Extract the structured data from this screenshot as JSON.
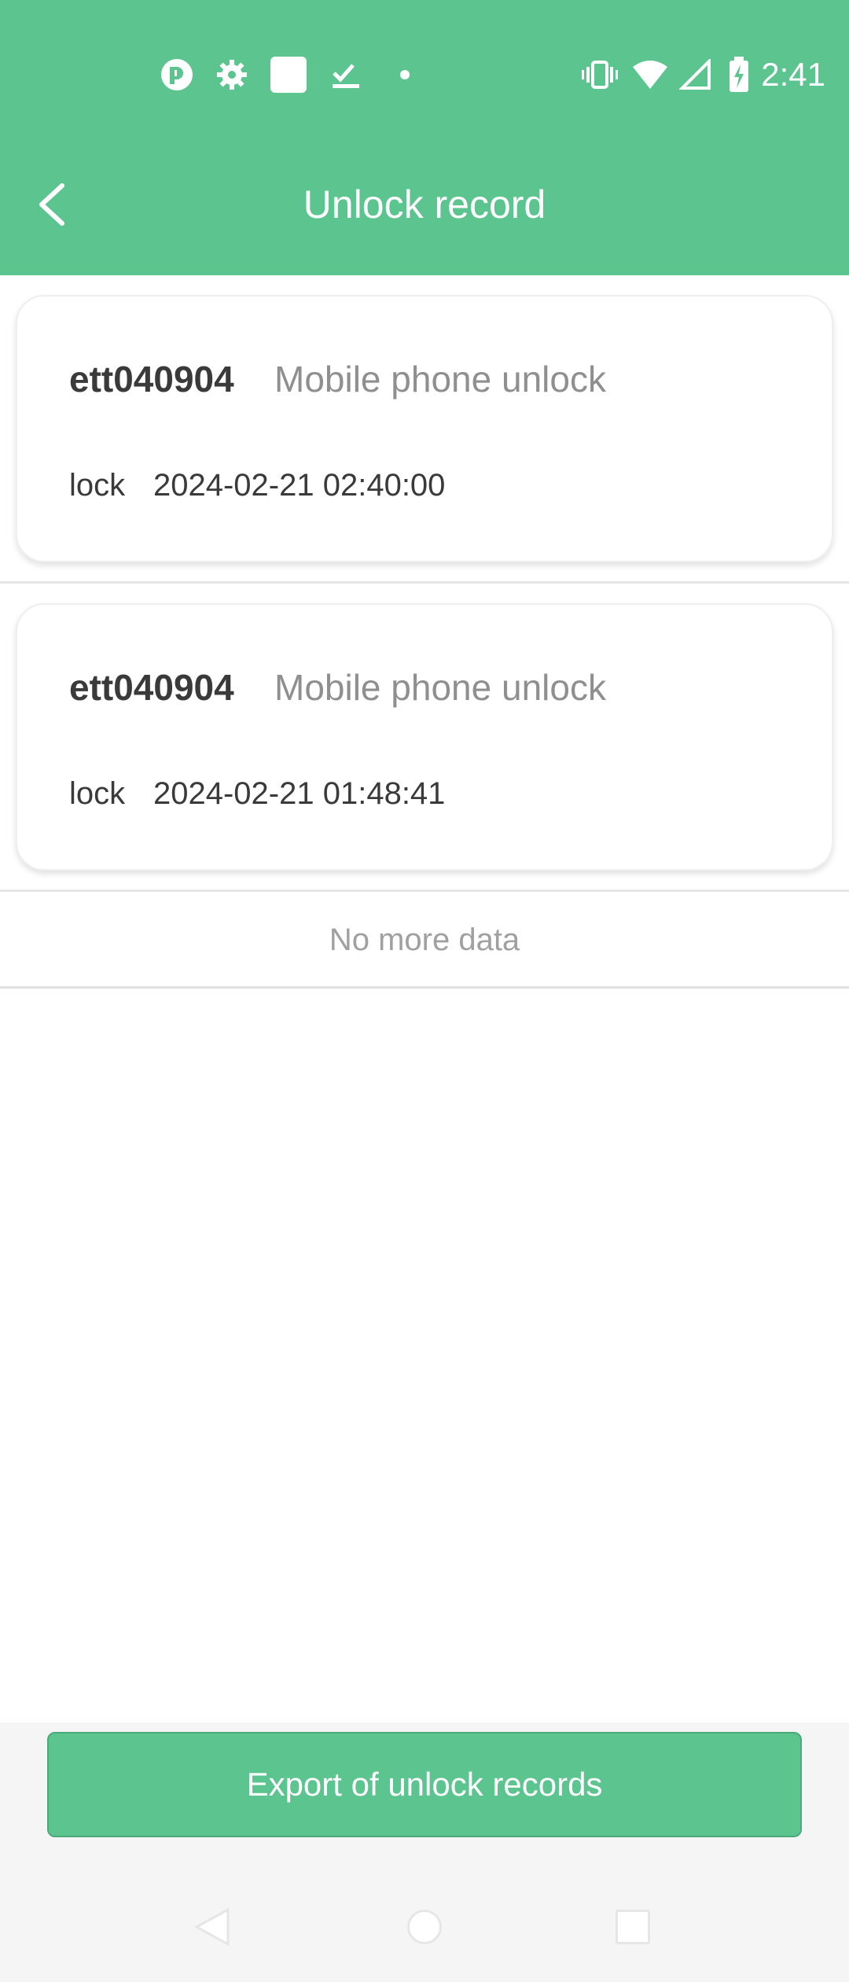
{
  "status_bar": {
    "time": "2:41",
    "icons": [
      "app-notification-icon",
      "settings-notification-icon",
      "square-notification-icon",
      "checklist-notification-icon",
      "dot-icon",
      "vibrate-icon",
      "wifi-icon",
      "signal-icon",
      "battery-charging-icon"
    ]
  },
  "header": {
    "title": "Unlock record",
    "back_icon": "chevron-left-icon"
  },
  "records": [
    {
      "user": "ett040904",
      "type": "Mobile phone unlock",
      "lock_label": "lock",
      "time": "2024-02-21 02:40:00"
    },
    {
      "user": "ett040904",
      "type": "Mobile phone unlock",
      "lock_label": "lock",
      "time": "2024-02-21 01:48:41"
    }
  ],
  "list_end_text": "No more data",
  "footer": {
    "export_label": "Export of unlock records"
  },
  "nav": {
    "back": "nav-back-icon",
    "home": "nav-home-icon",
    "recents": "nav-recents-icon"
  },
  "colors": {
    "accent": "#5bc48f",
    "text_primary": "#3a3a3a",
    "text_secondary": "#8f8f8f"
  }
}
